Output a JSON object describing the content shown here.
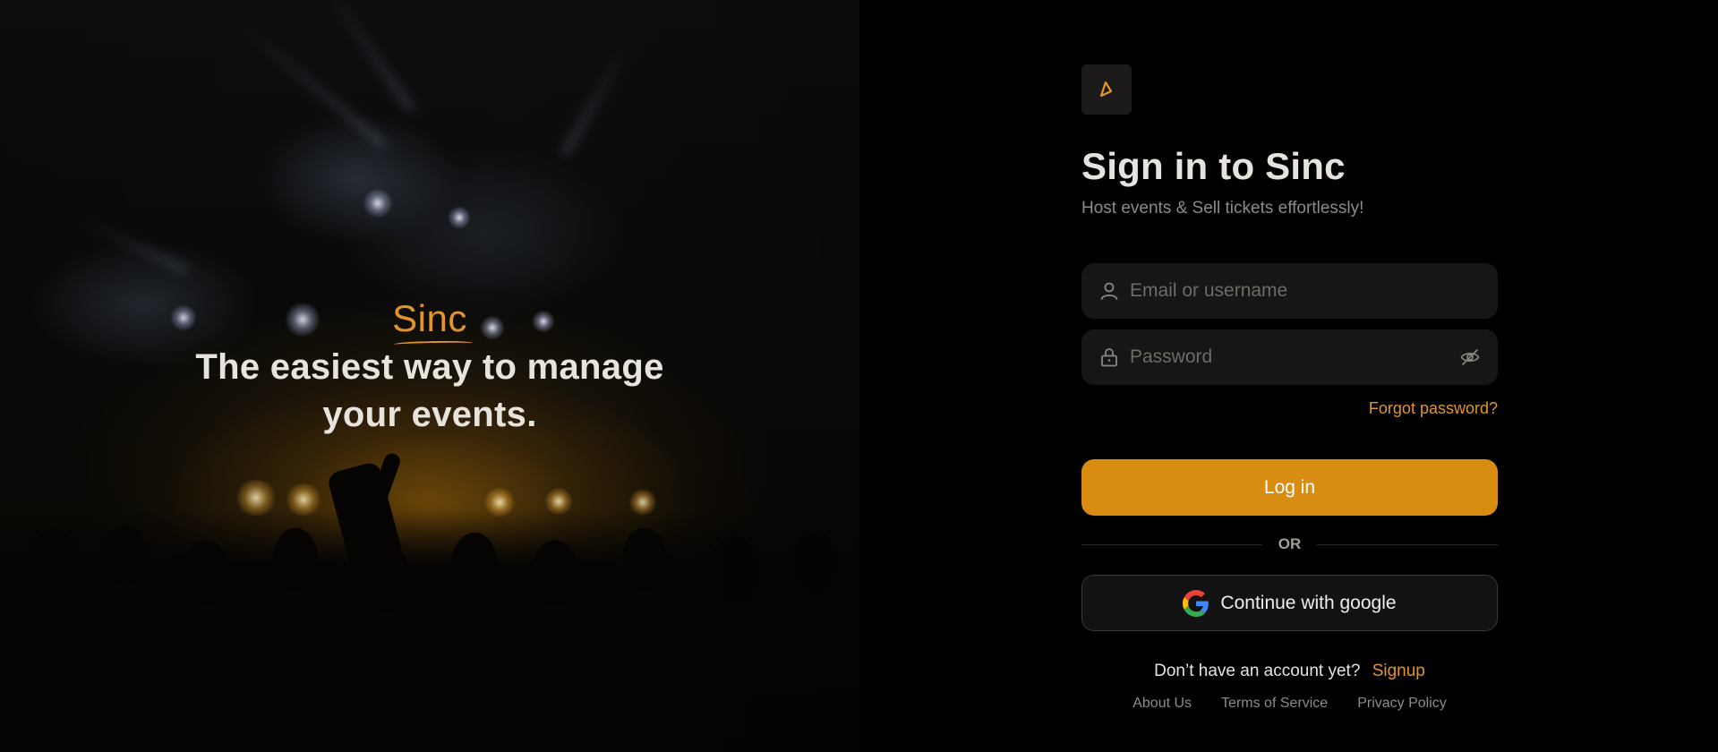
{
  "hero": {
    "brand": "Sinc",
    "tagline": "The easiest way to manage your events."
  },
  "logo": {
    "icon": "sinc-logo-icon",
    "color": "#e0942a"
  },
  "signin": {
    "title": "Sign in to Sinc",
    "subtitle": "Host events & Sell tickets effortlessly!",
    "email_placeholder": "Email or username",
    "password_placeholder": "Password",
    "forgot_password": "Forgot password?",
    "login_button": "Log in",
    "or_label": "OR",
    "google_button": "Continue with google",
    "signup_prompt": "Don’t have an account yet?",
    "signup_link": "Signup"
  },
  "footer": {
    "links": [
      "About Us",
      "Terms of Service",
      "Privacy Policy"
    ]
  },
  "colors": {
    "accent": "#e0942a",
    "button": "#d88d12",
    "background": "#000000",
    "input_bg": "#161616"
  }
}
